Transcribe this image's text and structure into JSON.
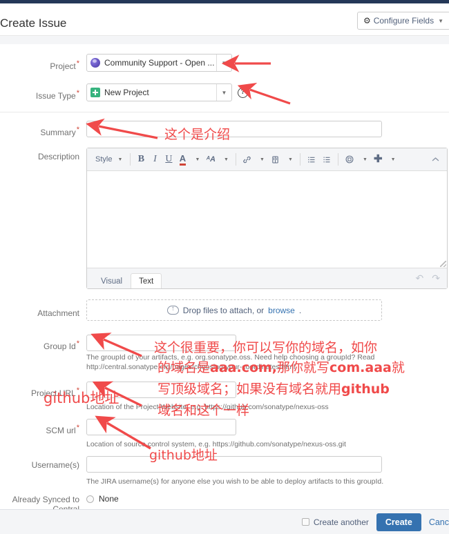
{
  "header": {
    "title": "Create Issue",
    "configure_fields_label": "Configure Fields",
    "gear_icon": "gear-icon",
    "caret_icon": "chevron-down-icon"
  },
  "fields": {
    "project": {
      "label": "Project",
      "required": true,
      "value": "Community Support - Open ...",
      "icon": "project-avatar-icon"
    },
    "issue_type": {
      "label": "Issue Type",
      "required": true,
      "value": "New Project",
      "icon": "new-project-icon",
      "help_icon": "question-mark-icon"
    },
    "summary": {
      "label": "Summary",
      "required": true,
      "value": "",
      "placeholder": ""
    },
    "description": {
      "label": "Description",
      "required": false,
      "value": "",
      "toolbar": {
        "style_label": "Style",
        "items": [
          {
            "name": "bold-icon",
            "glyph": "B"
          },
          {
            "name": "italic-icon",
            "glyph": "I"
          },
          {
            "name": "underline-icon",
            "glyph": "U"
          },
          {
            "name": "text-color-icon",
            "glyph": "A"
          },
          {
            "name": "text-effects-icon",
            "glyph": "ᴬA"
          },
          {
            "name": "link-icon",
            "glyph": "🔗"
          },
          {
            "name": "attachment-icon",
            "glyph": "▯"
          },
          {
            "name": "bullet-list-icon",
            "glyph": "☰"
          },
          {
            "name": "numbered-list-icon",
            "glyph": "☰"
          },
          {
            "name": "insert-icon",
            "glyph": "▣"
          },
          {
            "name": "plus-icon",
            "glyph": "✚"
          },
          {
            "name": "collapse-icon",
            "glyph": "⌃"
          }
        ]
      },
      "tabs": [
        {
          "label": "Visual",
          "active": false
        },
        {
          "label": "Text",
          "active": true
        }
      ],
      "undo_icon": "undo-icon",
      "redo_icon": "redo-icon"
    },
    "attachment": {
      "label": "Attachment",
      "drop_text": "Drop files to attach, or",
      "browse_label": "browse",
      "browse_suffix": ".",
      "cloud_icon": "upload-cloud-icon"
    },
    "group_id": {
      "label": "Group Id",
      "required": true,
      "value": "",
      "help_line1": "The groupId of your artifacts, e.g. org.sonatype.oss. Need help choosing a groupId? Read",
      "help_line2": "http://central.sonatype.org/pages/choosing-your-coordinates.html"
    },
    "project_url": {
      "label": "Project URL",
      "required": true,
      "value": "",
      "help": "Location of the Project Website, e.g. https://github.com/sonatype/nexus-oss"
    },
    "scm_url": {
      "label": "SCM url",
      "required": true,
      "value": "",
      "help": "Location of source control system, e.g. https://github.com/sonatype/nexus-oss.git"
    },
    "usernames": {
      "label": "Username(s)",
      "required": false,
      "value": "",
      "help": "The JIRA username(s) for anyone else you wish to be able to deploy artifacts to this groupId."
    },
    "already_synced": {
      "label_line1": "Already Synced to",
      "label_line2": "Central",
      "option_none": "None"
    }
  },
  "footer": {
    "create_another_label": "Create another",
    "create_label": "Create",
    "cancel_label": "Canc"
  },
  "annotations": {
    "summary_note": "这个是介绍",
    "groupid_note_line1": "这个很重要，你可以写你的域名，如你",
    "groupid_note_line2a": "的域名是",
    "groupid_note_line2b": "aaa.com,",
    "groupid_note_line2c": "那你就写",
    "groupid_note_line2d": "com.aaa",
    "groupid_note_line2e": "就",
    "groupid_note_line3a": "写顶级域名；如果没有域名就用",
    "groupid_note_line3b": "github",
    "groupid_note_line4": "域名和这个一样",
    "project_url_note": "github地址",
    "scm_url_note": "github地址",
    "color": "#f04a4a"
  }
}
